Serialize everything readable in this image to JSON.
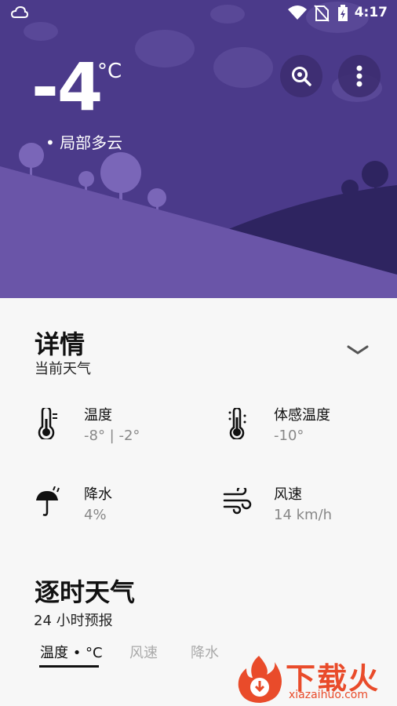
{
  "status_bar": {
    "time": "4:17"
  },
  "weather": {
    "temperature": "-4",
    "unit": "°C",
    "condition": "局部多云"
  },
  "details": {
    "title": "详情",
    "subtitle": "当前天气",
    "items": [
      {
        "label": "温度",
        "value": "-8° | -2°",
        "icon": "thermometer-icon"
      },
      {
        "label": "体感温度",
        "value": "-10°",
        "icon": "feels-like-thermometer-icon"
      },
      {
        "label": "降水",
        "value": "4%",
        "icon": "umbrella-rain-icon"
      },
      {
        "label": "风速",
        "value": "14 km/h",
        "icon": "wind-icon"
      }
    ]
  },
  "hourly": {
    "title": "逐时天气",
    "subtitle": "24 小时预报",
    "tabs": [
      "温度 • °C",
      "风速",
      "降水"
    ]
  },
  "watermark": {
    "name": "下载火",
    "url": "xiazaihuo.com"
  },
  "colors": {
    "hero_bg": "#4b3a8a",
    "hill": "#6a55a8",
    "accent": "#e94b2a"
  }
}
